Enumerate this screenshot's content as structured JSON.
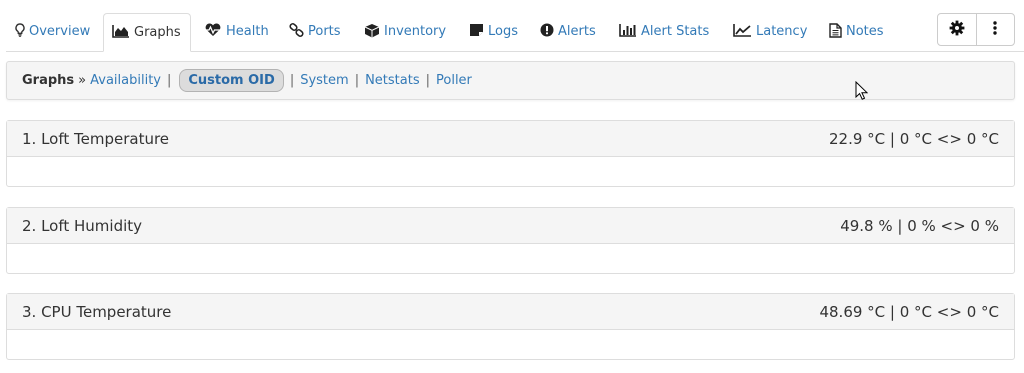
{
  "tabs": [
    {
      "id": "overview",
      "label": "Overview",
      "icon": "lightbulb-icon"
    },
    {
      "id": "graphs",
      "label": "Graphs",
      "icon": "area-chart-icon",
      "active": true
    },
    {
      "id": "health",
      "label": "Health",
      "icon": "heartbeat-icon"
    },
    {
      "id": "ports",
      "label": "Ports",
      "icon": "link-icon"
    },
    {
      "id": "inventory",
      "label": "Inventory",
      "icon": "cube-icon"
    },
    {
      "id": "logs",
      "label": "Logs",
      "icon": "sticky-note-icon"
    },
    {
      "id": "alerts",
      "label": "Alerts",
      "icon": "exclamation-circle-icon"
    },
    {
      "id": "alert-stats",
      "label": "Alert Stats",
      "icon": "bar-chart-icon"
    },
    {
      "id": "latency",
      "label": "Latency",
      "icon": "line-chart-icon"
    },
    {
      "id": "notes",
      "label": "Notes",
      "icon": "file-text-icon"
    }
  ],
  "toolbar": {
    "settings_icon": "gear-icon",
    "more_icon": "vertical-ellipsis-icon"
  },
  "subnav": {
    "title": "Graphs",
    "separator_arrow": "»",
    "links": [
      "Availability",
      "Custom OID",
      "System",
      "Netstats",
      "Poller"
    ],
    "active_link": "Custom OID",
    "pipe": "|"
  },
  "panels": [
    {
      "title": "1. Loft Temperature",
      "summary": "22.9 °C | 0 °C <> 0 °C"
    },
    {
      "title": "2. Loft Humidity",
      "summary": "49.8 % | 0 % <> 0 %"
    },
    {
      "title": "3. CPU Temperature",
      "summary": "48.69 °C | 0 °C <> 0 °C"
    }
  ],
  "colors": {
    "link": "#337ab7",
    "header_bg": "#f5f5f5",
    "border": "#dddddd",
    "active_pill_bg": "#dcdcdc"
  }
}
